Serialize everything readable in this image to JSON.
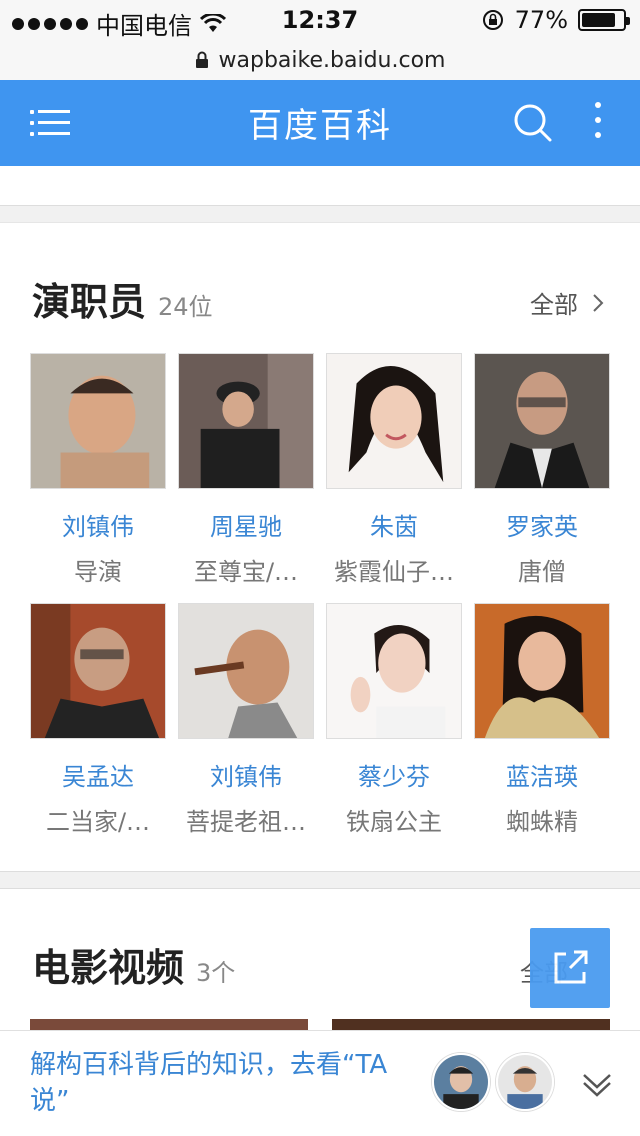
{
  "status": {
    "carrier": "中国电信",
    "time": "12:37",
    "battery": "77%",
    "battery_level": 0.77
  },
  "url": "wapbaike.baidu.com",
  "appbar": {
    "title": "百度百科"
  },
  "cast": {
    "title": "演职员",
    "count": "24位",
    "all_label": "全部",
    "people": [
      {
        "name": "刘镇伟",
        "role": "导演"
      },
      {
        "name": "周星驰",
        "role": "至尊宝/…"
      },
      {
        "name": "朱茵",
        "role": "紫霞仙子…"
      },
      {
        "name": "罗家英",
        "role": "唐僧"
      },
      {
        "name": "吴孟达",
        "role": "二当家/…"
      },
      {
        "name": "刘镇伟",
        "role": "菩提老祖…"
      },
      {
        "name": "蔡少芬",
        "role": "铁扇公主"
      },
      {
        "name": "蓝洁瑛",
        "role": "蜘蛛精"
      }
    ]
  },
  "films": {
    "title": "电影视频",
    "count": "3个",
    "all_label": "全部"
  },
  "promo": {
    "text": "解构百科背后的知识，去看“TA说”"
  },
  "colors": {
    "brand": "#3f95f0",
    "link": "#3a86d4"
  }
}
